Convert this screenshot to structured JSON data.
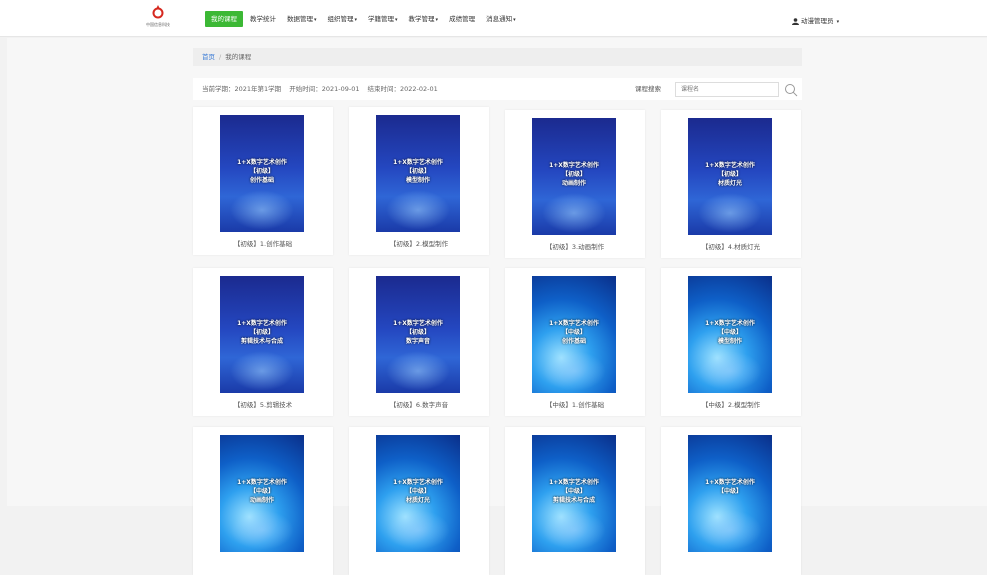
{
  "brand": {
    "logo_text": "中国信息科技",
    "accent": "#3cb835"
  },
  "nav": {
    "items": [
      {
        "label": "我的课程",
        "active": true,
        "dropdown": false
      },
      {
        "label": "教学统计",
        "active": false,
        "dropdown": false
      },
      {
        "label": "数据管理",
        "active": false,
        "dropdown": true
      },
      {
        "label": "组织管理",
        "active": false,
        "dropdown": true
      },
      {
        "label": "学籍管理",
        "active": false,
        "dropdown": true
      },
      {
        "label": "教学管理",
        "active": false,
        "dropdown": true
      },
      {
        "label": "成绩管理",
        "active": false,
        "dropdown": false
      },
      {
        "label": "消息通知",
        "active": false,
        "dropdown": true
      }
    ],
    "caret": "▾"
  },
  "user": {
    "name": "动漫管理员",
    "icon": "user-icon"
  },
  "breadcrumb": {
    "home": "首页",
    "separator": "/",
    "current": "我的课程"
  },
  "term_info": {
    "semester": "当前学期：2021年第1学期",
    "start": "开始时间：2021-09-01",
    "end": "结束时间：2022-02-01"
  },
  "search": {
    "label": "课程搜索",
    "placeholder": "课程名",
    "icon": "search-icon"
  },
  "courses": [
    {
      "title": "【初级】1.创作基础",
      "cover_lines": [
        "1+X数字艺术创作",
        "【初级】",
        "创作基础"
      ],
      "style": "primary"
    },
    {
      "title": "【初级】2.模型制作",
      "cover_lines": [
        "1+X数字艺术创作",
        "【初级】",
        "模型制作"
      ],
      "style": "primary"
    },
    {
      "title": "【初级】3.动画制作",
      "cover_lines": [
        "1+X数字艺术创作",
        "【初级】",
        "动画制作"
      ],
      "style": "primary"
    },
    {
      "title": "【初级】4.材质灯光",
      "cover_lines": [
        "1+X数字艺术创作",
        "【初级】",
        "材质灯光"
      ],
      "style": "primary"
    },
    {
      "title": "【初级】5.剪辑技术",
      "cover_lines": [
        "1+X数字艺术创作",
        "【初级】",
        "剪辑技术与合成"
      ],
      "style": "primary"
    },
    {
      "title": "【初级】6.数字声音",
      "cover_lines": [
        "1+X数字艺术创作",
        "【初级】",
        "数字声音"
      ],
      "style": "primary"
    },
    {
      "title": "【中级】1.创作基础",
      "cover_lines": [
        "1+X数字艺术创作",
        "【中级】",
        "创作基础"
      ],
      "style": "middle"
    },
    {
      "title": "【中级】2.模型制作",
      "cover_lines": [
        "1+X数字艺术创作",
        "【中级】",
        "模型制作"
      ],
      "style": "middle"
    },
    {
      "title": "",
      "cover_lines": [
        "1+X数字艺术创作",
        "【中级】",
        "动画制作"
      ],
      "style": "middle"
    },
    {
      "title": "",
      "cover_lines": [
        "1+X数字艺术创作",
        "【中级】",
        "材质灯光"
      ],
      "style": "middle"
    },
    {
      "title": "",
      "cover_lines": [
        "1+X数字艺术创作",
        "【中级】",
        "剪辑技术与合成"
      ],
      "style": "middle"
    },
    {
      "title": "",
      "cover_lines": [
        "1+X数字艺术创作",
        "【中级】",
        ""
      ],
      "style": "middle"
    }
  ]
}
